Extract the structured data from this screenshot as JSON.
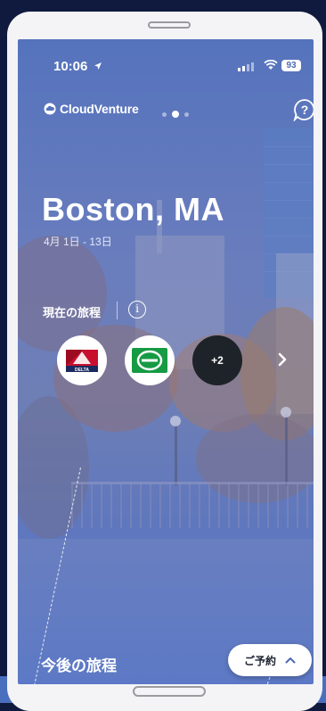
{
  "status_bar": {
    "time": "10:06",
    "battery": "93"
  },
  "header": {
    "brand": "CloudVenture",
    "page_count": 3,
    "active_page": 2,
    "help_icon": "question-bubble-icon"
  },
  "trip": {
    "city": "Boston, MA",
    "dates": "4月 1日 - 13日"
  },
  "current_itinerary": {
    "label": "現在の旅程",
    "info_icon": "info-icon",
    "providers": [
      {
        "name": "DELTA",
        "type": "airline",
        "color": "#c8102e"
      },
      {
        "name": "enterprise-logo",
        "type": "car-rental",
        "color": "#169a43"
      }
    ],
    "more_count": "+2"
  },
  "footer": {
    "upcoming_label": "今後の旅程",
    "book_label": "ご予約"
  },
  "colors": {
    "accent": "#5573bd",
    "dark_circle": "#1d2329",
    "delta_red": "#c8102e",
    "enterprise_green": "#169a43"
  }
}
